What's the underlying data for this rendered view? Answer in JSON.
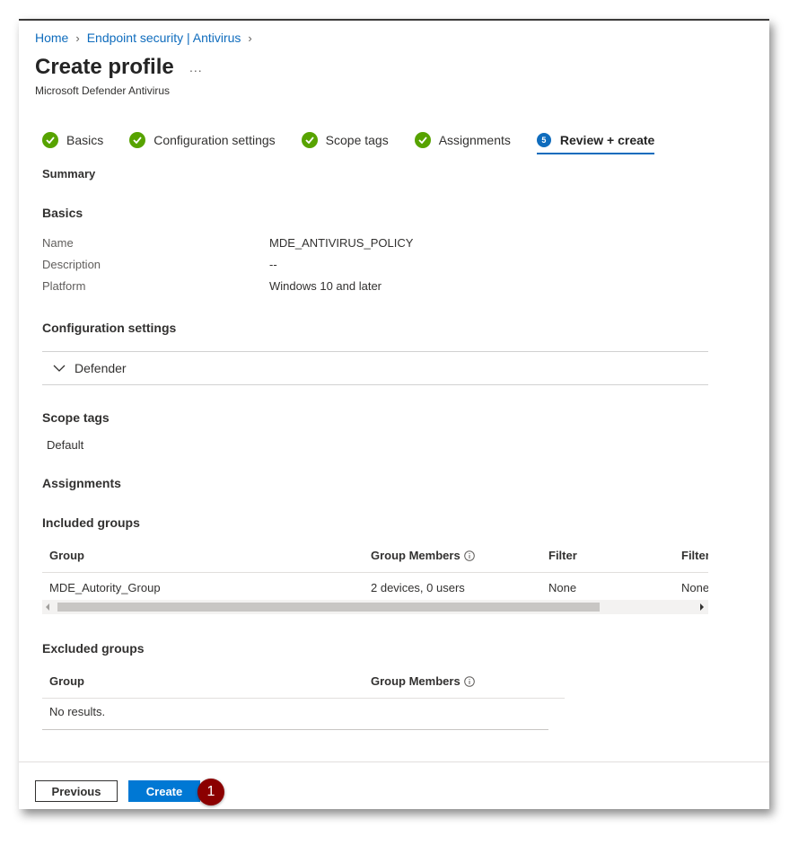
{
  "breadcrumb": {
    "items": [
      "Home",
      "Endpoint security | Antivirus"
    ]
  },
  "header": {
    "title": "Create profile",
    "more": "...",
    "subtitle": "Microsoft Defender Antivirus"
  },
  "steps": [
    {
      "label": "Basics",
      "state": "complete"
    },
    {
      "label": "Configuration settings",
      "state": "complete"
    },
    {
      "label": "Scope tags",
      "state": "complete"
    },
    {
      "label": "Assignments",
      "state": "complete"
    },
    {
      "label": "Review + create",
      "state": "active",
      "number": "5"
    }
  ],
  "summary": {
    "heading": "Summary",
    "basics": {
      "heading": "Basics",
      "rows": [
        {
          "label": "Name",
          "value": "MDE_ANTIVIRUS_POLICY"
        },
        {
          "label": "Description",
          "value": "--"
        },
        {
          "label": "Platform",
          "value": "Windows 10 and later"
        }
      ]
    },
    "configuration": {
      "heading": "Configuration settings",
      "accordion_label": "Defender"
    },
    "scope_tags": {
      "heading": "Scope tags",
      "value": "Default"
    },
    "assignments": {
      "heading": "Assignments",
      "included": {
        "heading": "Included groups",
        "columns": [
          "Group",
          "Group Members",
          "Filter",
          "Filter"
        ],
        "rows": [
          [
            "MDE_Autority_Group",
            "2 devices, 0 users",
            "None",
            "None"
          ]
        ]
      },
      "excluded": {
        "heading": "Excluded groups",
        "columns": [
          "Group",
          "Group Members"
        ],
        "empty_text": "No results."
      }
    }
  },
  "footer": {
    "previous_label": "Previous",
    "create_label": "Create",
    "callout_number": "1"
  },
  "colors": {
    "accent": "#0078d4",
    "link": "#0f6cbd",
    "success": "#57a300",
    "callout": "#8b0000"
  }
}
